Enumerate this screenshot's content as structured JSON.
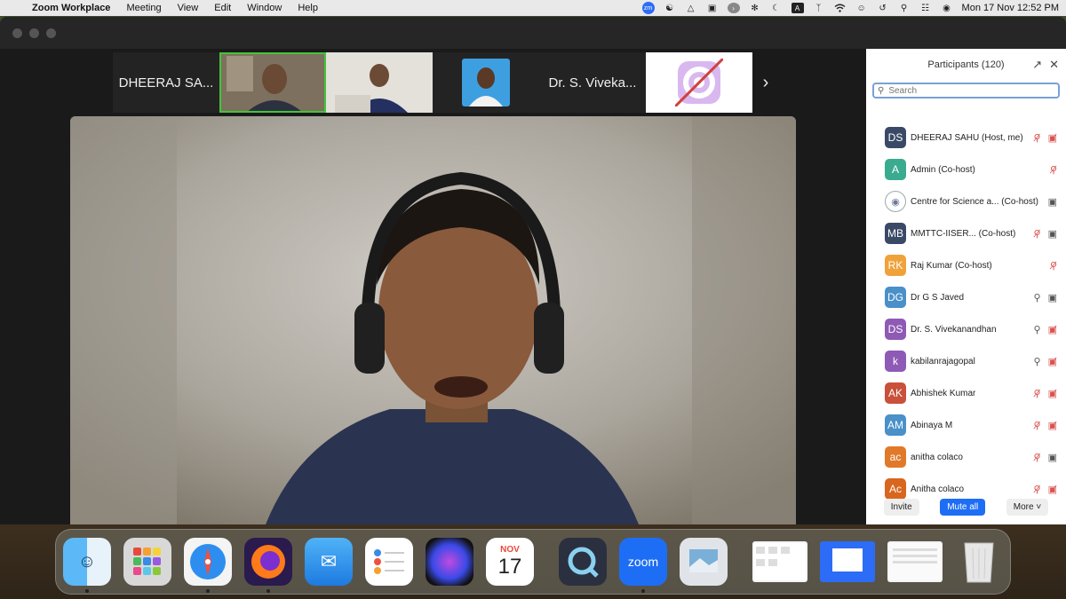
{
  "menubar": {
    "app_name": "Zoom Workplace",
    "menus": [
      "Meeting",
      "View",
      "Edit",
      "Window",
      "Help"
    ],
    "tray_a_label": "A",
    "clock": "Mon 17 Nov  12:52 PM"
  },
  "strip": {
    "tiles": [
      {
        "label": "DHEERAJ SA..."
      },
      {
        "label": "Dr. S. Viveka..."
      }
    ]
  },
  "panel": {
    "title": "Participants (120)",
    "search_placeholder": "Search",
    "participants": [
      {
        "initials": "DS",
        "name": "DHEERAJ SAHU (Host, me)",
        "color": "#3a4a66",
        "mic": "muted",
        "video": "off"
      },
      {
        "initials": "A",
        "name": "Admin (Co-host)",
        "color": "#3bab8f",
        "mic": "muted",
        "video": "none"
      },
      {
        "initials": "",
        "name": "Centre for Science a...  (Co-host)",
        "color": "#ffffff",
        "mic": "none",
        "video": "on"
      },
      {
        "initials": "MB",
        "name": "MMTTC-IISER...      (Co-host)",
        "color": "#3a4a66",
        "mic": "muted",
        "video": "on"
      },
      {
        "initials": "RK",
        "name": "Raj Kumar (Co-host)",
        "color": "#f0a23a",
        "mic": "muted",
        "video": "none"
      },
      {
        "initials": "DG",
        "name": "Dr G S Javed",
        "color": "#4a90c9",
        "mic": "on",
        "video": "on"
      },
      {
        "initials": "DS",
        "name": "Dr. S. Vivekanandhan",
        "color": "#8e5ab5",
        "mic": "on",
        "video": "off"
      },
      {
        "initials": "k",
        "name": "kabilanrajagopal",
        "color": "#8e5ab5",
        "mic": "on",
        "video": "off"
      },
      {
        "initials": "AK",
        "name": "Abhishek Kumar",
        "color": "#c9503a",
        "mic": "muted",
        "video": "off"
      },
      {
        "initials": "AM",
        "name": "Abinaya M",
        "color": "#4a90c9",
        "mic": "muted",
        "video": "off"
      },
      {
        "initials": "ac",
        "name": "anitha colaco",
        "color": "#e07a2a",
        "mic": "muted",
        "video": "on"
      },
      {
        "initials": "Ac",
        "name": "Anitha colaco",
        "color": "#d9661f",
        "mic": "muted",
        "video": "off"
      }
    ],
    "footer": {
      "invite": "Invite",
      "mute_all": "Mute all",
      "more": "More"
    }
  },
  "dock": {
    "calendar_month": "NOV",
    "calendar_day": "17",
    "zoom_label": "zoom"
  }
}
